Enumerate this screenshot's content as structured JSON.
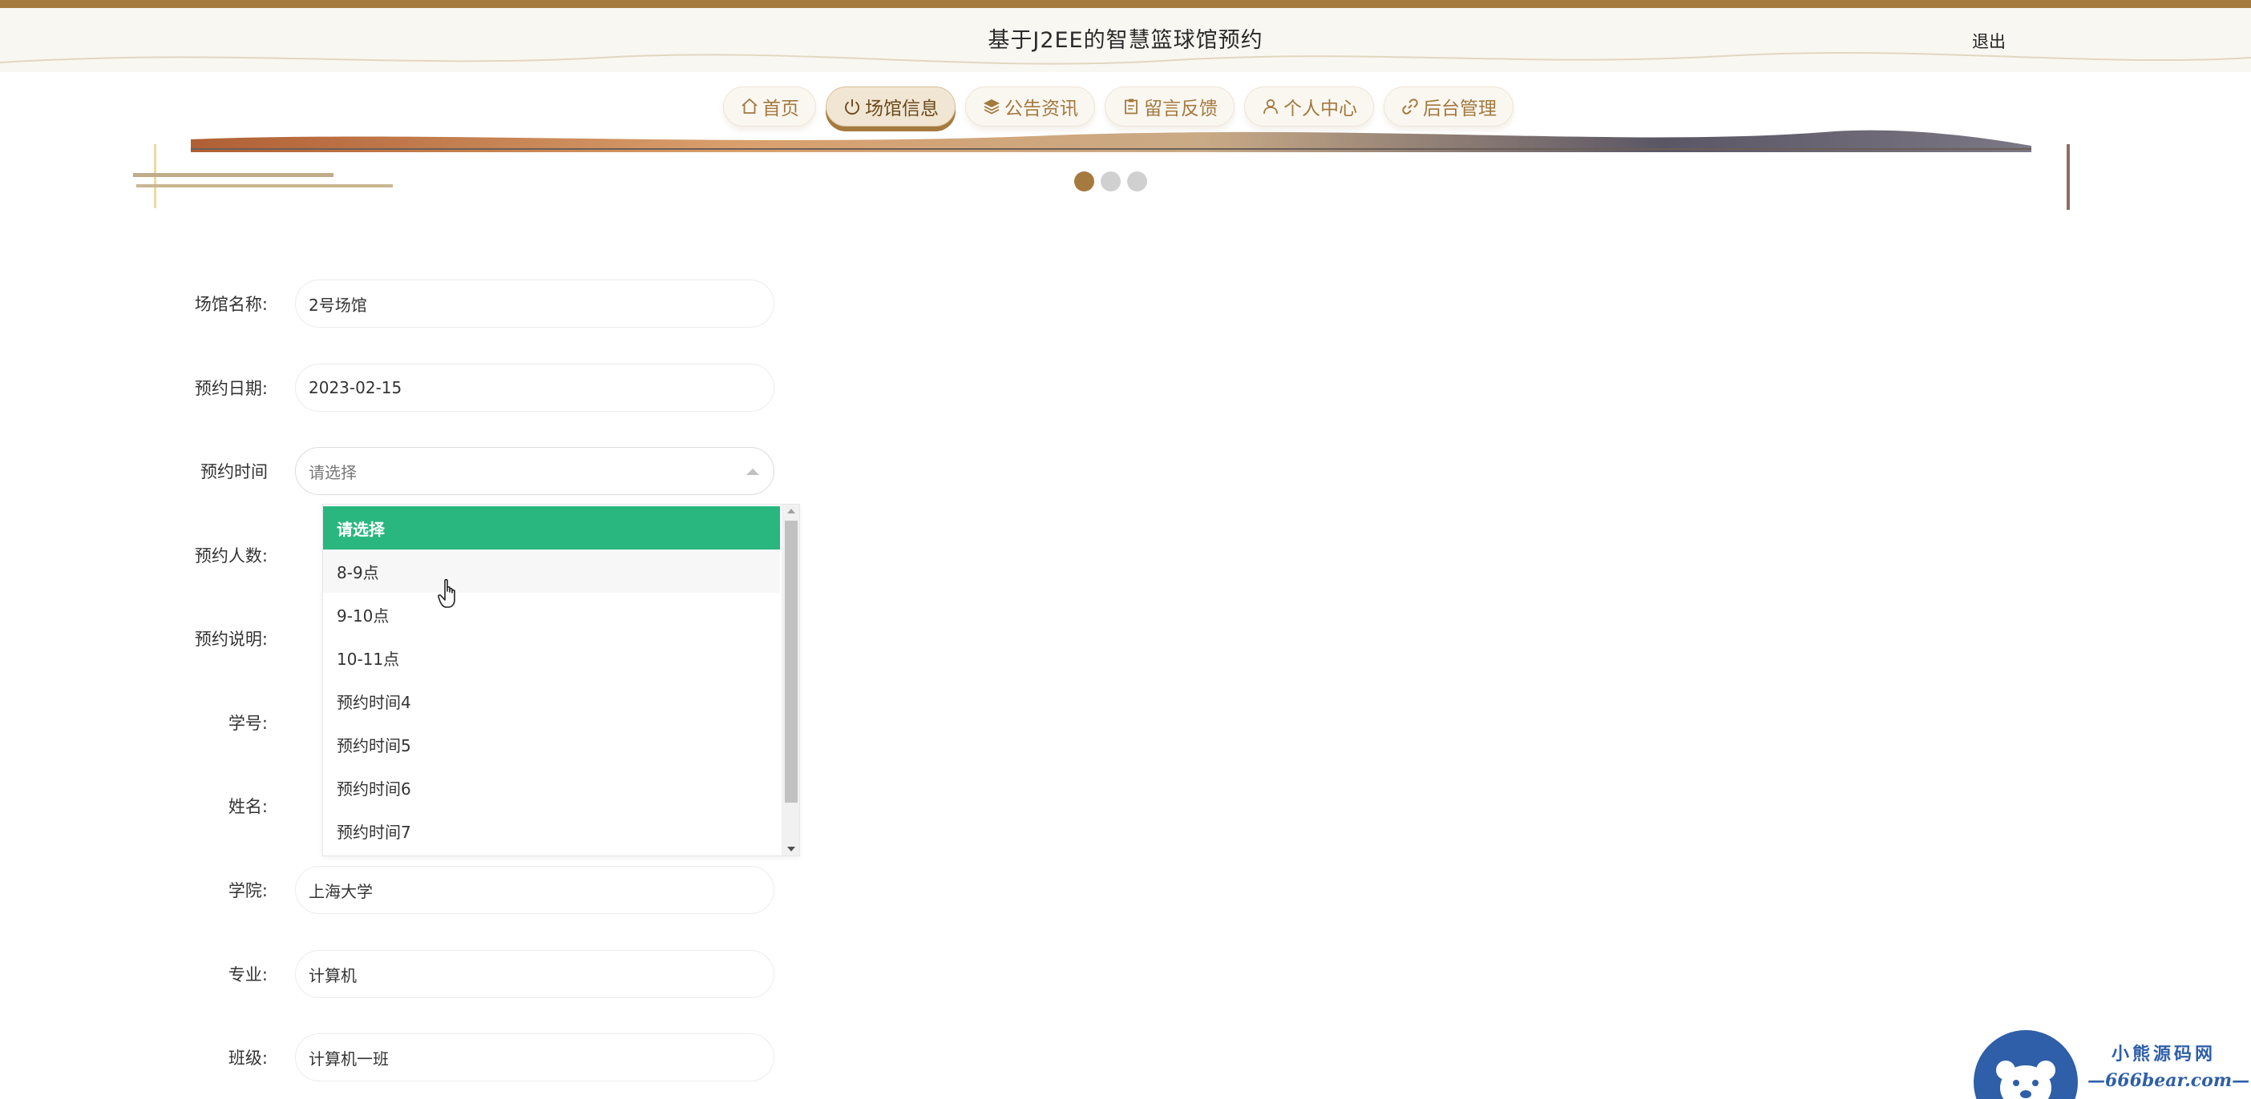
{
  "header": {
    "title": "基于J2EE的智慧篮球馆预约",
    "logout_label": "退出"
  },
  "nav": {
    "items": [
      {
        "label": "首页",
        "icon": "home-icon"
      },
      {
        "label": "场馆信息",
        "icon": "power-icon",
        "active": true
      },
      {
        "label": "公告资讯",
        "icon": "layers-icon"
      },
      {
        "label": "留言反馈",
        "icon": "clipboard-icon"
      },
      {
        "label": "个人中心",
        "icon": "user-icon"
      },
      {
        "label": "后台管理",
        "icon": "link-icon"
      }
    ]
  },
  "carousel": {
    "slide_count": 3,
    "active_index": 0
  },
  "form": {
    "venue_name": {
      "label": "场馆名称:",
      "value": "2号场馆"
    },
    "booking_date": {
      "label": "预约日期:",
      "value": "2023-02-15"
    },
    "booking_time": {
      "label": "预约时间",
      "placeholder": "请选择"
    },
    "people_count": {
      "label": "预约人数:"
    },
    "description": {
      "label": "预约说明:"
    },
    "student_id": {
      "label": "学号:"
    },
    "name": {
      "label": "姓名:"
    },
    "college": {
      "label": "学院:",
      "value": "上海大学"
    },
    "major": {
      "label": "专业:",
      "value": "计算机"
    },
    "class": {
      "label": "班级:",
      "value": "计算机一班"
    }
  },
  "time_dropdown": {
    "options": [
      "请选择",
      "8-9点",
      "9-10点",
      "10-11点",
      "预约时间4",
      "预约时间5",
      "预约时间6",
      "预约时间7"
    ],
    "selected_index": 0,
    "hover_index": 1
  },
  "watermark": {
    "title": "小熊源码网",
    "url": "—666bear.com—"
  },
  "colors": {
    "brand": "#a57a3f",
    "selected_option": "#2ab67f",
    "watermark": "#2e5fa8"
  }
}
